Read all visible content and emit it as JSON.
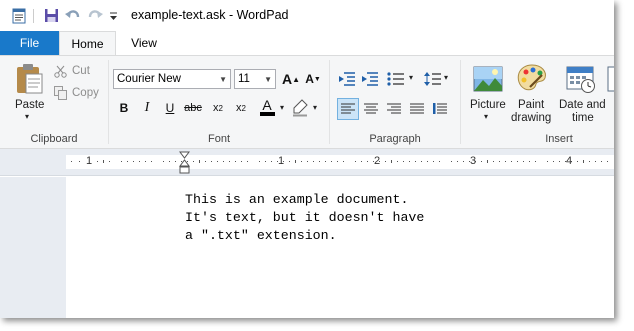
{
  "window": {
    "title": "example-text.ask - WordPad"
  },
  "quick_access": {
    "icons": [
      "wordpad-app-icon",
      "save-icon",
      "undo-icon",
      "redo-icon",
      "customize-toolbar-icon"
    ]
  },
  "tabs": [
    {
      "label": "File",
      "active": false
    },
    {
      "label": "Home",
      "active": true
    },
    {
      "label": "View",
      "active": false
    }
  ],
  "ribbon": {
    "clipboard": {
      "label": "Clipboard",
      "paste_label": "Paste",
      "cut_label": "Cut",
      "copy_label": "Copy"
    },
    "font": {
      "label": "Font",
      "family_value": "Courier New",
      "size_value": "11",
      "buttons": [
        "bold",
        "italic",
        "underline",
        "strikethrough",
        "subscript",
        "superscript",
        "text-color",
        "highlight-color"
      ]
    },
    "paragraph": {
      "label": "Paragraph",
      "buttons": [
        "decrease-indent",
        "increase-indent",
        "bullets",
        "line-spacing",
        "align-left",
        "align-center",
        "align-right",
        "justify",
        "paragraph-dialog"
      ],
      "active_alignment": "align-left"
    },
    "insert": {
      "label": "Insert",
      "picture_label": "Picture",
      "paint_label_1": "Paint",
      "paint_label_2": "drawing",
      "datetime_label_1": "Date and",
      "datetime_label_2": "time"
    }
  },
  "ruler": {
    "numbers": [
      "1",
      "1",
      "2",
      "3",
      "4"
    ]
  },
  "document": {
    "lines": [
      "This is an example document.",
      "It's text, but it doesn't have",
      "a \".txt\" extension."
    ]
  },
  "colors": {
    "file_tab": "#1979ca",
    "ribbon_bg": "#f5f6f7",
    "canvas_bg": "#e8ecf2",
    "text_color_bar": "#000000"
  }
}
